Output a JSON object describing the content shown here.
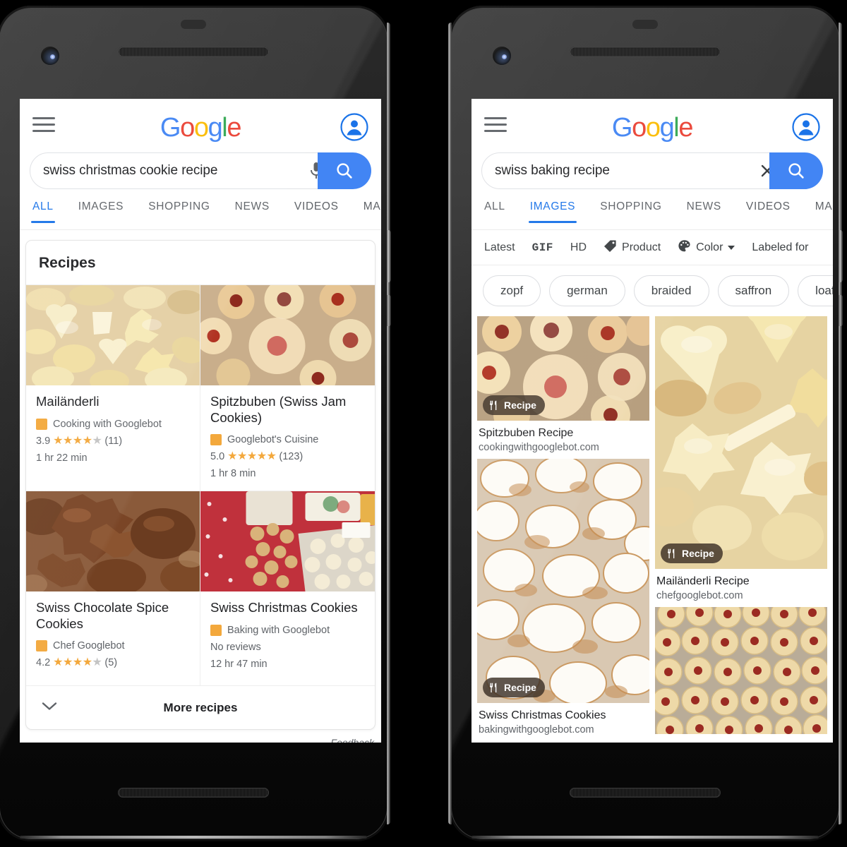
{
  "left_phone": {
    "header": {
      "menu_icon": "hamburger-icon",
      "logo": "Google",
      "logo_letters": [
        "G",
        "o",
        "o",
        "g",
        "l",
        "e"
      ],
      "account_icon": "account-circle-icon"
    },
    "search": {
      "value": "swiss christmas cookie recipe",
      "placeholder": "Search",
      "mic_icon": "microphone-icon",
      "submit_icon": "search-icon"
    },
    "tabs": [
      {
        "label": "ALL",
        "active": true
      },
      {
        "label": "IMAGES",
        "active": false
      },
      {
        "label": "SHOPPING",
        "active": false
      },
      {
        "label": "NEWS",
        "active": false
      },
      {
        "label": "VIDEOS",
        "active": false
      },
      {
        "label": "MAPS",
        "active": false
      }
    ],
    "recipes_card": {
      "title": "Recipes",
      "items": [
        {
          "name": "Mailänderli",
          "source": "Cooking with Googlebot",
          "rating": "3.9",
          "stars_full": 4,
          "stars_total": 5,
          "reviews": "(11)",
          "time": "1 hr 22 min"
        },
        {
          "name": "Spitzbuben (Swiss Jam Cookies)",
          "source": "Googlebot's Cuisine",
          "rating": "5.0",
          "stars_full": 5,
          "stars_total": 5,
          "reviews": "(123)",
          "time": "1 hr 8 min"
        },
        {
          "name": "Swiss Chocolate Spice Cookies",
          "source": "Chef Googlebot",
          "rating": "4.2",
          "stars_full": 4,
          "stars_total": 5,
          "reviews": "(5)",
          "time": ""
        },
        {
          "name": "Swiss Christmas Cookies",
          "source": "Baking with Googlebot",
          "rating": "",
          "stars_full": 0,
          "stars_total": 0,
          "reviews": "No reviews",
          "time": "12 hr 47 min"
        }
      ],
      "more_label": "More recipes",
      "more_icon": "chevron-down-icon",
      "feedback_label": "Feedback"
    }
  },
  "right_phone": {
    "header": {
      "menu_icon": "hamburger-icon",
      "logo": "Google",
      "logo_letters": [
        "G",
        "o",
        "o",
        "g",
        "l",
        "e"
      ],
      "account_icon": "account-circle-icon"
    },
    "search": {
      "value": "swiss baking recipe",
      "placeholder": "Search",
      "clear_icon": "close-icon",
      "submit_icon": "search-icon"
    },
    "tabs": [
      {
        "label": "ALL",
        "active": false
      },
      {
        "label": "IMAGES",
        "active": true
      },
      {
        "label": "SHOPPING",
        "active": false
      },
      {
        "label": "NEWS",
        "active": false
      },
      {
        "label": "VIDEOS",
        "active": false
      },
      {
        "label": "MAPS",
        "active": false
      }
    ],
    "filters": [
      {
        "label": "Latest",
        "icon": null,
        "caret": false
      },
      {
        "label": "GIF",
        "icon": null,
        "caret": false
      },
      {
        "label": "HD",
        "icon": null,
        "caret": false
      },
      {
        "label": "Product",
        "icon": "tag-icon",
        "caret": false
      },
      {
        "label": "Color",
        "icon": "palette-icon",
        "caret": true
      },
      {
        "label": "Labeled for",
        "icon": null,
        "caret": false
      }
    ],
    "chips": [
      "zopf",
      "german",
      "braided",
      "saffron",
      "loaf"
    ],
    "results": [
      {
        "title": "Spitzbuben Recipe",
        "url": "cookingwithgooglebot.com",
        "badge": "Recipe",
        "badge_icon": "cutlery-icon"
      },
      {
        "title": "",
        "url": "",
        "badge": null,
        "badge_icon": null
      },
      {
        "title": "Mailänderli Recipe",
        "url": "chefgooglebot.com",
        "badge": "Recipe",
        "badge_icon": "cutlery-icon"
      },
      {
        "title": "Swiss Christmas Cookies",
        "url": "bakingwithgooglebot.com",
        "badge": "Recipe",
        "badge_icon": "cutlery-icon"
      },
      {
        "title": "",
        "url": "",
        "badge": null,
        "badge_icon": null
      }
    ]
  },
  "colors": {
    "google_blue": "#4285F4",
    "google_red": "#EA4335",
    "google_yellow": "#FBBC05",
    "google_green": "#34A853",
    "link_blue": "#1a73e8",
    "star_gold": "#F3A83C",
    "text_primary": "#202124",
    "text_secondary": "#5f6368"
  }
}
